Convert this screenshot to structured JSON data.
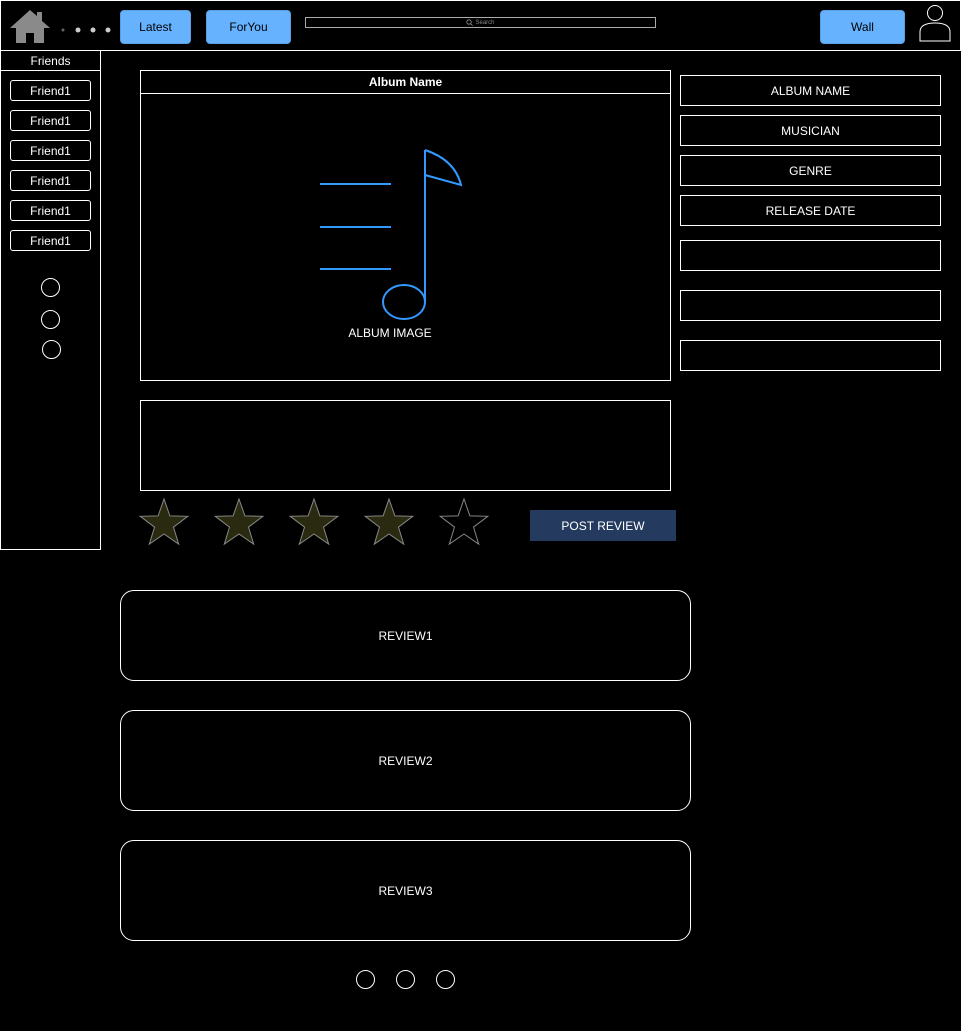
{
  "topbar": {
    "home_icon": "home-icon",
    "dots_icon": "more-dots-icon",
    "latest_label": "Latest",
    "foryou_label": "ForYou",
    "search_placeholder": "Search",
    "wall_label": "Wall",
    "profile_icon": "user-icon"
  },
  "sidebar": {
    "title": "Friends",
    "friends": [
      "Friend1",
      "Friend1",
      "Friend1",
      "Friend1",
      "Friend1",
      "Friend1"
    ]
  },
  "album": {
    "title": "Album Name",
    "image_label": "ALBUM IMAGE",
    "image_icon": "music-note-icon",
    "accent_color": "#3399ff"
  },
  "info": {
    "name_label": "ALBUM NAME",
    "musician_label": "MUSICIAN",
    "genre_label": "GENRE",
    "release_label": "RELEASE DATE"
  },
  "rating": {
    "value": 4,
    "max": 5,
    "filled_color": "#2a2a10"
  },
  "post_review_label": "POST REVIEW",
  "reviews": [
    "REVIEW1",
    "REVIEW2",
    "REVIEW3"
  ]
}
